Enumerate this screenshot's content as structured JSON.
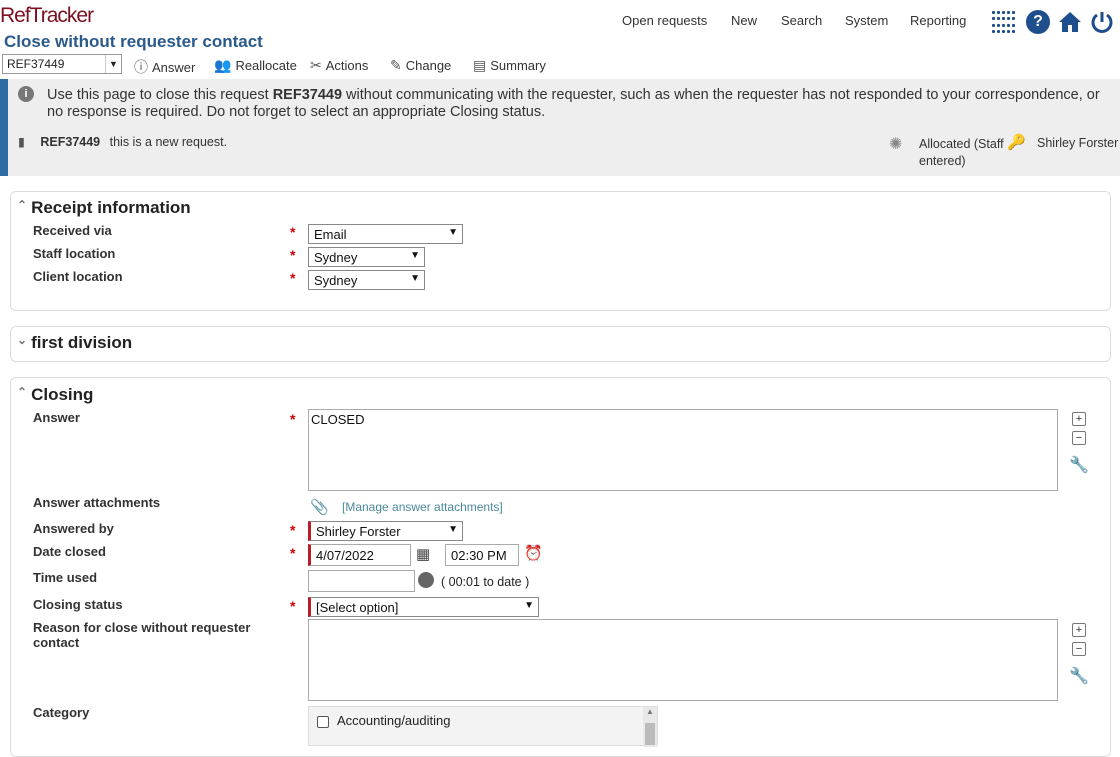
{
  "app": {
    "logo": "RefTracker",
    "page_title": "Close without requester contact"
  },
  "nav": {
    "items": [
      "Open requests",
      "New",
      "Search",
      "System",
      "Reporting"
    ]
  },
  "toolbar": {
    "ref_value": "REF37449",
    "answer": "Answer",
    "reallocate": "Reallocate",
    "actions": "Actions",
    "change": "Change",
    "summary": "Summary"
  },
  "info": {
    "pre": "Use this page to close this request ",
    "ref": "REF37449",
    "post": " without communicating with the requester, such as when the requester has not responded to your correspondence, or no response is required. Do not forget to select an appropriate Closing status.",
    "line_ref": "REF37449",
    "line_desc": "this is a new request.",
    "status": "Allocated (Staff entered)",
    "staff": "Shirley Forster"
  },
  "receipt": {
    "title": "Receipt information",
    "received_via_label": "Received via",
    "received_via_value": "Email",
    "staff_location_label": "Staff location",
    "staff_location_value": "Sydney",
    "client_location_label": "Client location",
    "client_location_value": "Sydney"
  },
  "division": {
    "title": "first division"
  },
  "closing": {
    "title": "Closing",
    "answer_label": "Answer",
    "answer_value": "CLOSED",
    "attachments_label": "Answer attachments",
    "attachments_link": "[Manage answer attachments]",
    "answered_by_label": "Answered by",
    "answered_by_value": "Shirley Forster",
    "date_closed_label": "Date closed",
    "date_value": "4/07/2022",
    "time_value": "02:30 PM",
    "time_used_label": "Time used",
    "time_used_value": "",
    "time_to_date": "( 00:01 to date )",
    "closing_status_label": "Closing status",
    "closing_status_value": "[Select option]",
    "reason_label": "Reason for close without requester contact",
    "category_label": "Category",
    "category_first": "Accounting/auditing"
  },
  "colors": {
    "brand": "#7a1020",
    "accent": "#2a5a8a",
    "required": "#b81e2a"
  }
}
